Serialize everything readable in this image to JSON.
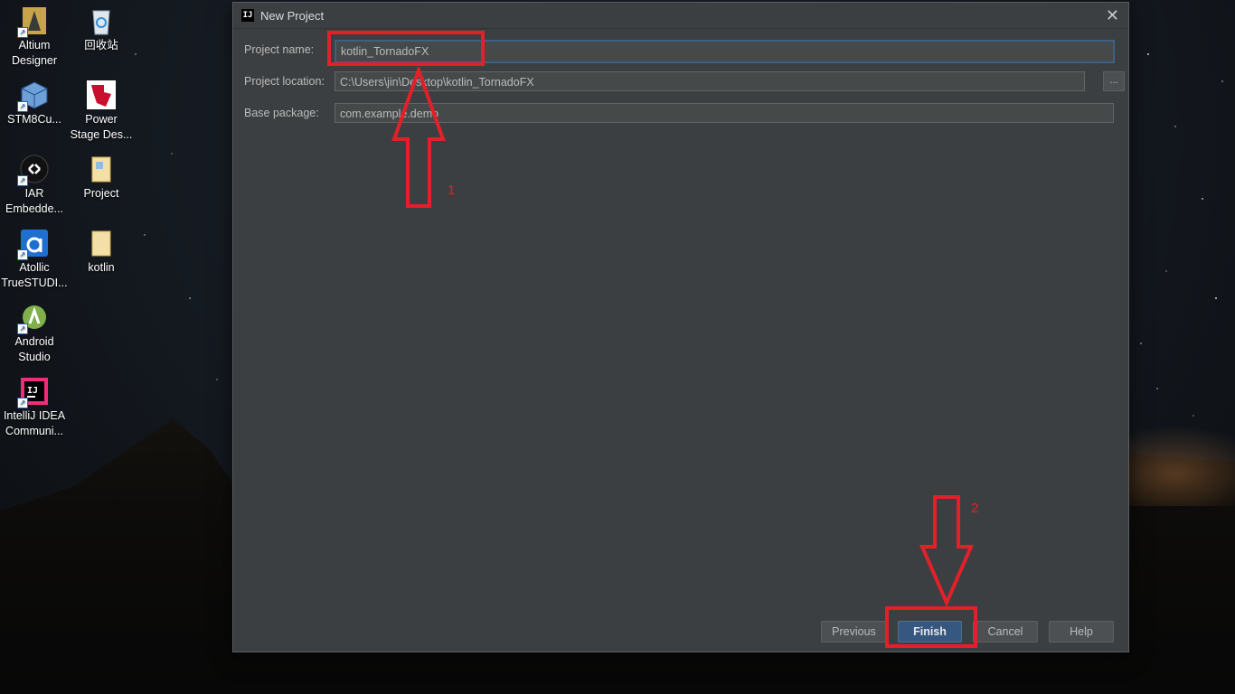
{
  "desktop": {
    "icons": [
      {
        "label": "Altium\nDesigner",
        "icon": "altium-icon"
      },
      {
        "label": "回收站",
        "icon": "recycle-bin-icon"
      },
      {
        "label": "STM8Cu...",
        "icon": "stm8-cube-icon"
      },
      {
        "label": "Power\nStage Des...",
        "icon": "ti-power-stage-icon"
      },
      {
        "label": "IAR\nEmbedde...",
        "icon": "iar-icon"
      },
      {
        "label": "Project",
        "icon": "folder-icon"
      },
      {
        "label": "Atollic\nTrueSTUDI...",
        "icon": "atollic-icon"
      },
      {
        "label": "kotlin",
        "icon": "folder-icon"
      },
      {
        "label": "Android\nStudio",
        "icon": "android-studio-icon"
      },
      {
        "label": "IntelliJ IDEA\nCommuni...",
        "icon": "intellij-icon"
      }
    ]
  },
  "dialog": {
    "title": "New Project",
    "app_icon_text": "IJ",
    "close_glyph": "✕",
    "fields": {
      "project_name": {
        "label": "Project name:",
        "value": "kotlin_TornadoFX"
      },
      "project_location": {
        "label": "Project location:",
        "value": "C:\\Users\\jin\\Desktop\\kotlin_TornadoFX"
      },
      "base_package": {
        "label": "Base package:",
        "value": "com.example.demo"
      }
    },
    "browse_label": "...",
    "buttons": {
      "previous": "Previous",
      "finish": "Finish",
      "cancel": "Cancel",
      "help": "Help"
    }
  },
  "annotations": {
    "step1": "1",
    "step2": "2",
    "color": "#e3202a"
  }
}
